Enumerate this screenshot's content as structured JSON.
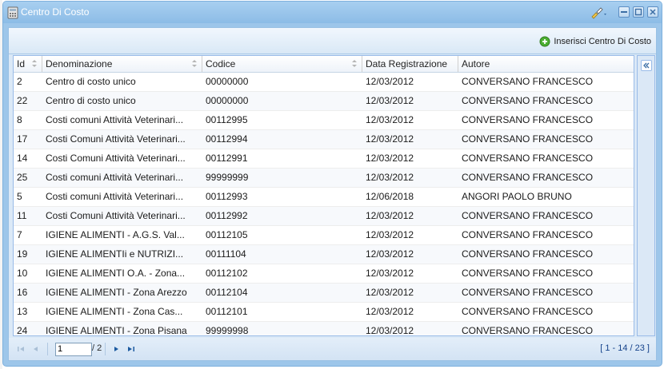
{
  "window": {
    "title": "Centro Di Costo"
  },
  "toolbar": {
    "add_label": "Inserisci Centro Di Costo"
  },
  "grid": {
    "columns": [
      {
        "label": "Id",
        "sortable": true
      },
      {
        "label": "Denominazione",
        "sortable": true
      },
      {
        "label": "Codice",
        "sortable": true
      },
      {
        "label": "Data Registrazione",
        "sortable": false
      },
      {
        "label": "Autore",
        "sortable": false
      }
    ],
    "rows": [
      {
        "id": "2",
        "denominazione": "Centro di costo unico",
        "codice": "00000000",
        "data": "12/03/2012",
        "autore": "CONVERSANO FRANCESCO"
      },
      {
        "id": "22",
        "denominazione": "Centro di costo unico",
        "codice": "00000000",
        "data": "12/03/2012",
        "autore": "CONVERSANO FRANCESCO"
      },
      {
        "id": "8",
        "denominazione": "Costi comuni Attività Veterinari...",
        "codice": "00112995",
        "data": "12/03/2012",
        "autore": "CONVERSANO FRANCESCO"
      },
      {
        "id": "17",
        "denominazione": "Costi Comuni Attività Veterinari...",
        "codice": "00112994",
        "data": "12/03/2012",
        "autore": "CONVERSANO FRANCESCO"
      },
      {
        "id": "14",
        "denominazione": "Costi Comuni Attività Veterinari...",
        "codice": "00112991",
        "data": "12/03/2012",
        "autore": "CONVERSANO FRANCESCO"
      },
      {
        "id": "25",
        "denominazione": "Costi comuni Attività Veterinari...",
        "codice": "99999999",
        "data": "12/03/2012",
        "autore": "CONVERSANO FRANCESCO"
      },
      {
        "id": "5",
        "denominazione": "Costi comuni Attività Veterinari...",
        "codice": "00112993",
        "data": "12/06/2018",
        "autore": "ANGORI PAOLO BRUNO"
      },
      {
        "id": "11",
        "denominazione": "Costi Comuni Attività Veterinari...",
        "codice": "00112992",
        "data": "12/03/2012",
        "autore": "CONVERSANO FRANCESCO"
      },
      {
        "id": "7",
        "denominazione": "IGIENE ALIMENTI - A.G.S. Val...",
        "codice": "00112105",
        "data": "12/03/2012",
        "autore": "CONVERSANO FRANCESCO"
      },
      {
        "id": "19",
        "denominazione": "IGIENE ALIMENTIi e NUTRIZI...",
        "codice": "00111104",
        "data": "12/03/2012",
        "autore": "CONVERSANO FRANCESCO"
      },
      {
        "id": "10",
        "denominazione": "IGIENE ALIMENTI O.A. - Zona...",
        "codice": "00112102",
        "data": "12/03/2012",
        "autore": "CONVERSANO FRANCESCO"
      },
      {
        "id": "16",
        "denominazione": "IGIENE ALIMENTI - Zona Arezzo",
        "codice": "00112104",
        "data": "12/03/2012",
        "autore": "CONVERSANO FRANCESCO"
      },
      {
        "id": "13",
        "denominazione": "IGIENE ALIMENTI - Zona Cas...",
        "codice": "00112101",
        "data": "12/03/2012",
        "autore": "CONVERSANO FRANCESCO"
      },
      {
        "id": "24",
        "denominazione": "IGIENE ALIMENTI - Zona Pisana",
        "codice": "99999998",
        "data": "12/03/2012",
        "autore": "CONVERSANO FRANCESCO"
      }
    ]
  },
  "pager": {
    "page_value": "1",
    "page_of": "/ 2",
    "display_info": "[ 1 - 14 / 23 ]"
  },
  "colors": {
    "accent": "#9dc6ea",
    "add_icon": "#4caf32",
    "pager_text": "#15428b"
  },
  "icons": {
    "title": "calculator-icon",
    "tool": "brush-icon",
    "add": "add-circle-icon",
    "collapse": "double-chevron-left-icon"
  }
}
